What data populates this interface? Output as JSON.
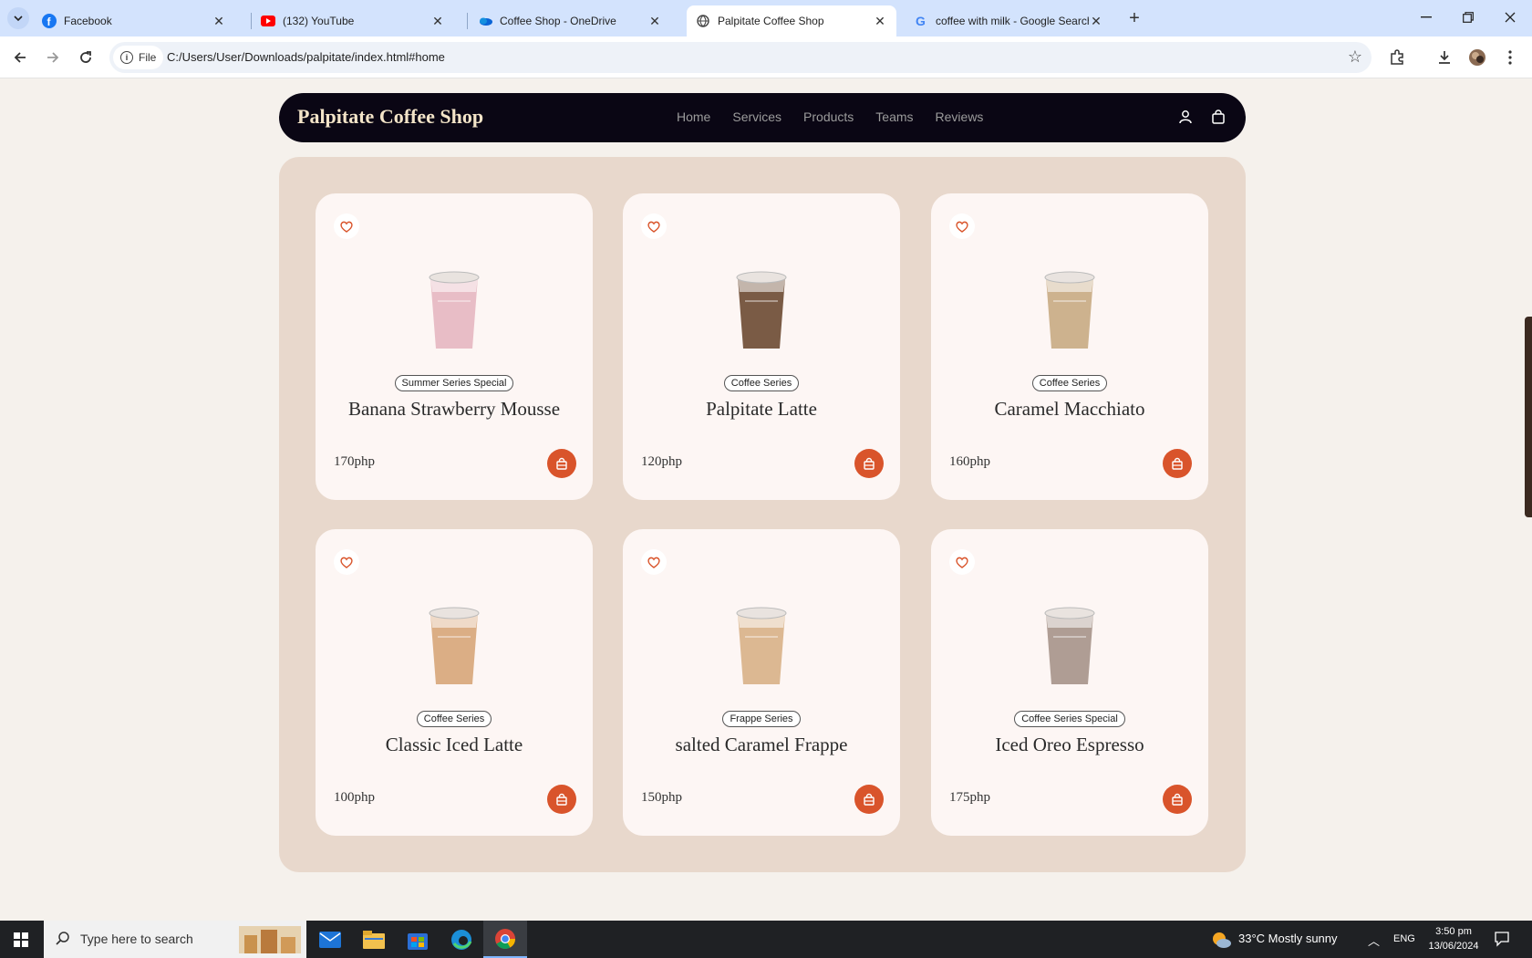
{
  "browser": {
    "tabs": [
      {
        "title": "Facebook",
        "icon": "facebook-icon"
      },
      {
        "title": "(132) YouTube",
        "icon": "youtube-icon"
      },
      {
        "title": "Coffee Shop - OneDrive",
        "icon": "onedrive-icon"
      },
      {
        "title": "Palpitate Coffee Shop",
        "icon": "globe-icon",
        "active": true
      },
      {
        "title": "coffee with milk - Google Search",
        "icon": "google-icon"
      }
    ],
    "site_chip": "File",
    "url": "C:/Users/User/Downloads/palpitate/index.html#home"
  },
  "page": {
    "brand": "Palpitate Coffee Shop",
    "nav": [
      "Home",
      "Services",
      "Products",
      "Teams",
      "Reviews"
    ],
    "products": [
      {
        "category": "Summer Series Special",
        "name": "Banana Strawberry Mousse",
        "price": "170php",
        "drink_color": "#e6b7c1"
      },
      {
        "category": "Coffee Series",
        "name": "Palpitate Latte",
        "price": "120php",
        "drink_color": "#6b4a32"
      },
      {
        "category": "Coffee Series",
        "name": "Caramel Macchiato",
        "price": "160php",
        "drink_color": "#c8ab83"
      },
      {
        "category": "Coffee Series",
        "name": "Classic Iced Latte",
        "price": "100php",
        "drink_color": "#d7a679"
      },
      {
        "category": "Frappe Series",
        "name": "salted Caramel Frappe",
        "price": "150php",
        "drink_color": "#d8b187"
      },
      {
        "category": "Coffee Series Special",
        "name": "Iced Oreo Espresso",
        "price": "175php",
        "drink_color": "#a6938a"
      }
    ],
    "colors": {
      "accent": "#d9542b",
      "navbar": "#0a0614",
      "panel": "#e8d8cc",
      "card": "#fdf6f4"
    }
  },
  "taskbar": {
    "search_placeholder": "Type here to search",
    "weather": "33°C  Mostly sunny",
    "language": "ENG",
    "time": "3:50 pm",
    "date": "13/06/2024"
  }
}
